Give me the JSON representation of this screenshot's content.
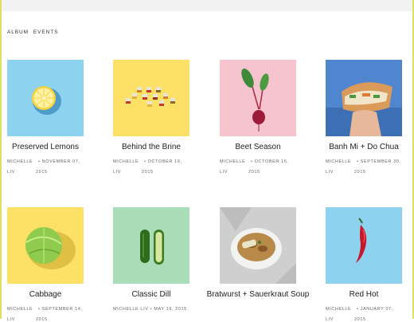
{
  "nav": {
    "album": "ALBUM",
    "events": "EVENTS"
  },
  "posts": [
    {
      "title": "Preserved Lemons",
      "author1": "MICHELLE",
      "author2": "LIV",
      "date1": "• NOVEMBER 07,",
      "date2": "2015",
      "image_icon": "lemon-half",
      "bg": "#8dd3f0"
    },
    {
      "title": "Behind the Brine",
      "author1": "MICHELLE",
      "author2": "LIV",
      "date1": "• OCTOBER 19,",
      "date2": "2015",
      "image_icon": "spice-jars",
      "bg": "#fde066"
    },
    {
      "title": "Beet Season",
      "author1": "MICHELLE",
      "author2": "LIV",
      "date1": "• OCTOBER 16,",
      "date2": "2015",
      "image_icon": "beet",
      "bg": "#f6c4cf"
    },
    {
      "title": "Banh Mi + Do Chua",
      "author1": "MICHELLE",
      "author2": "LIV",
      "date1": "• SEPTEMBER 30,",
      "date2": "2015",
      "image_icon": "sandwich-in-hand",
      "bg": "#4f86cf"
    },
    {
      "title": "Cabbage",
      "author1": "MICHELLE",
      "author2": "LIV",
      "date1": "• SEPTEMBER 14,",
      "date2": "2015",
      "image_icon": "cabbage",
      "bg": "#fde066"
    },
    {
      "title": "Classic Dill",
      "meta": "MICHELLE LIV • MAY 19, 2015",
      "image_icon": "pickles",
      "bg": "#a9ddb7"
    },
    {
      "title": "Bratwurst + Sauerkraut Soup",
      "image_icon": "soup-bowl",
      "bg": "#cfcfcf"
    },
    {
      "title": "Red Hot",
      "author1": "MICHELLE",
      "author2": "LIV",
      "date1": "• JANUARY 07,",
      "date2": "2015",
      "image_icon": "red-chili",
      "bg": "#8dd3f0"
    }
  ]
}
